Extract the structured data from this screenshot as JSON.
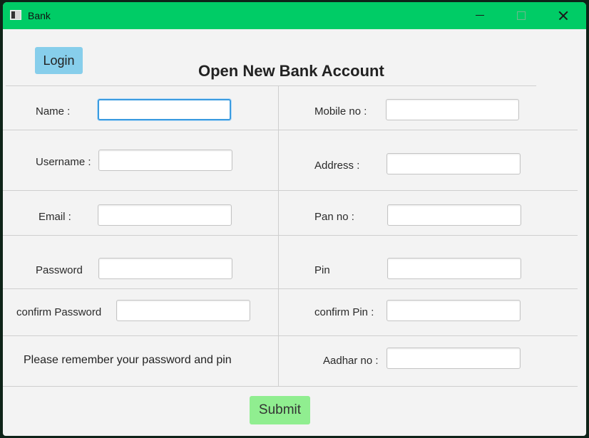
{
  "window": {
    "title": "Bank"
  },
  "header": {
    "login_label": "Login",
    "heading": "Open New Bank Account"
  },
  "form": {
    "name_label": "Name :",
    "mobile_label": "Mobile no :",
    "username_label": "Username :",
    "address_label": "Address :",
    "email_label": "Email :",
    "pan_label": "Pan no :",
    "password_label": "Password",
    "pin_label": "Pin",
    "confirm_password_label": "confirm Password",
    "confirm_pin_label": "confirm Pin :",
    "aadhar_label": "Aadhar no :",
    "note": "Please remember your password and pin",
    "values": {
      "name": "",
      "mobile": "",
      "username": "",
      "address": "",
      "email": "",
      "pan": "",
      "password": "",
      "pin": "",
      "confirm_password": "",
      "confirm_pin": "",
      "aadhar": ""
    }
  },
  "footer": {
    "submit_label": "Submit"
  },
  "colors": {
    "titlebar": "#00cc66",
    "login_button": "#87ceeb",
    "submit_button": "#90ee90",
    "focus_ring": "#3a9be0"
  },
  "icons": [
    "app-icon",
    "minimize-icon",
    "maximize-icon",
    "close-icon"
  ]
}
